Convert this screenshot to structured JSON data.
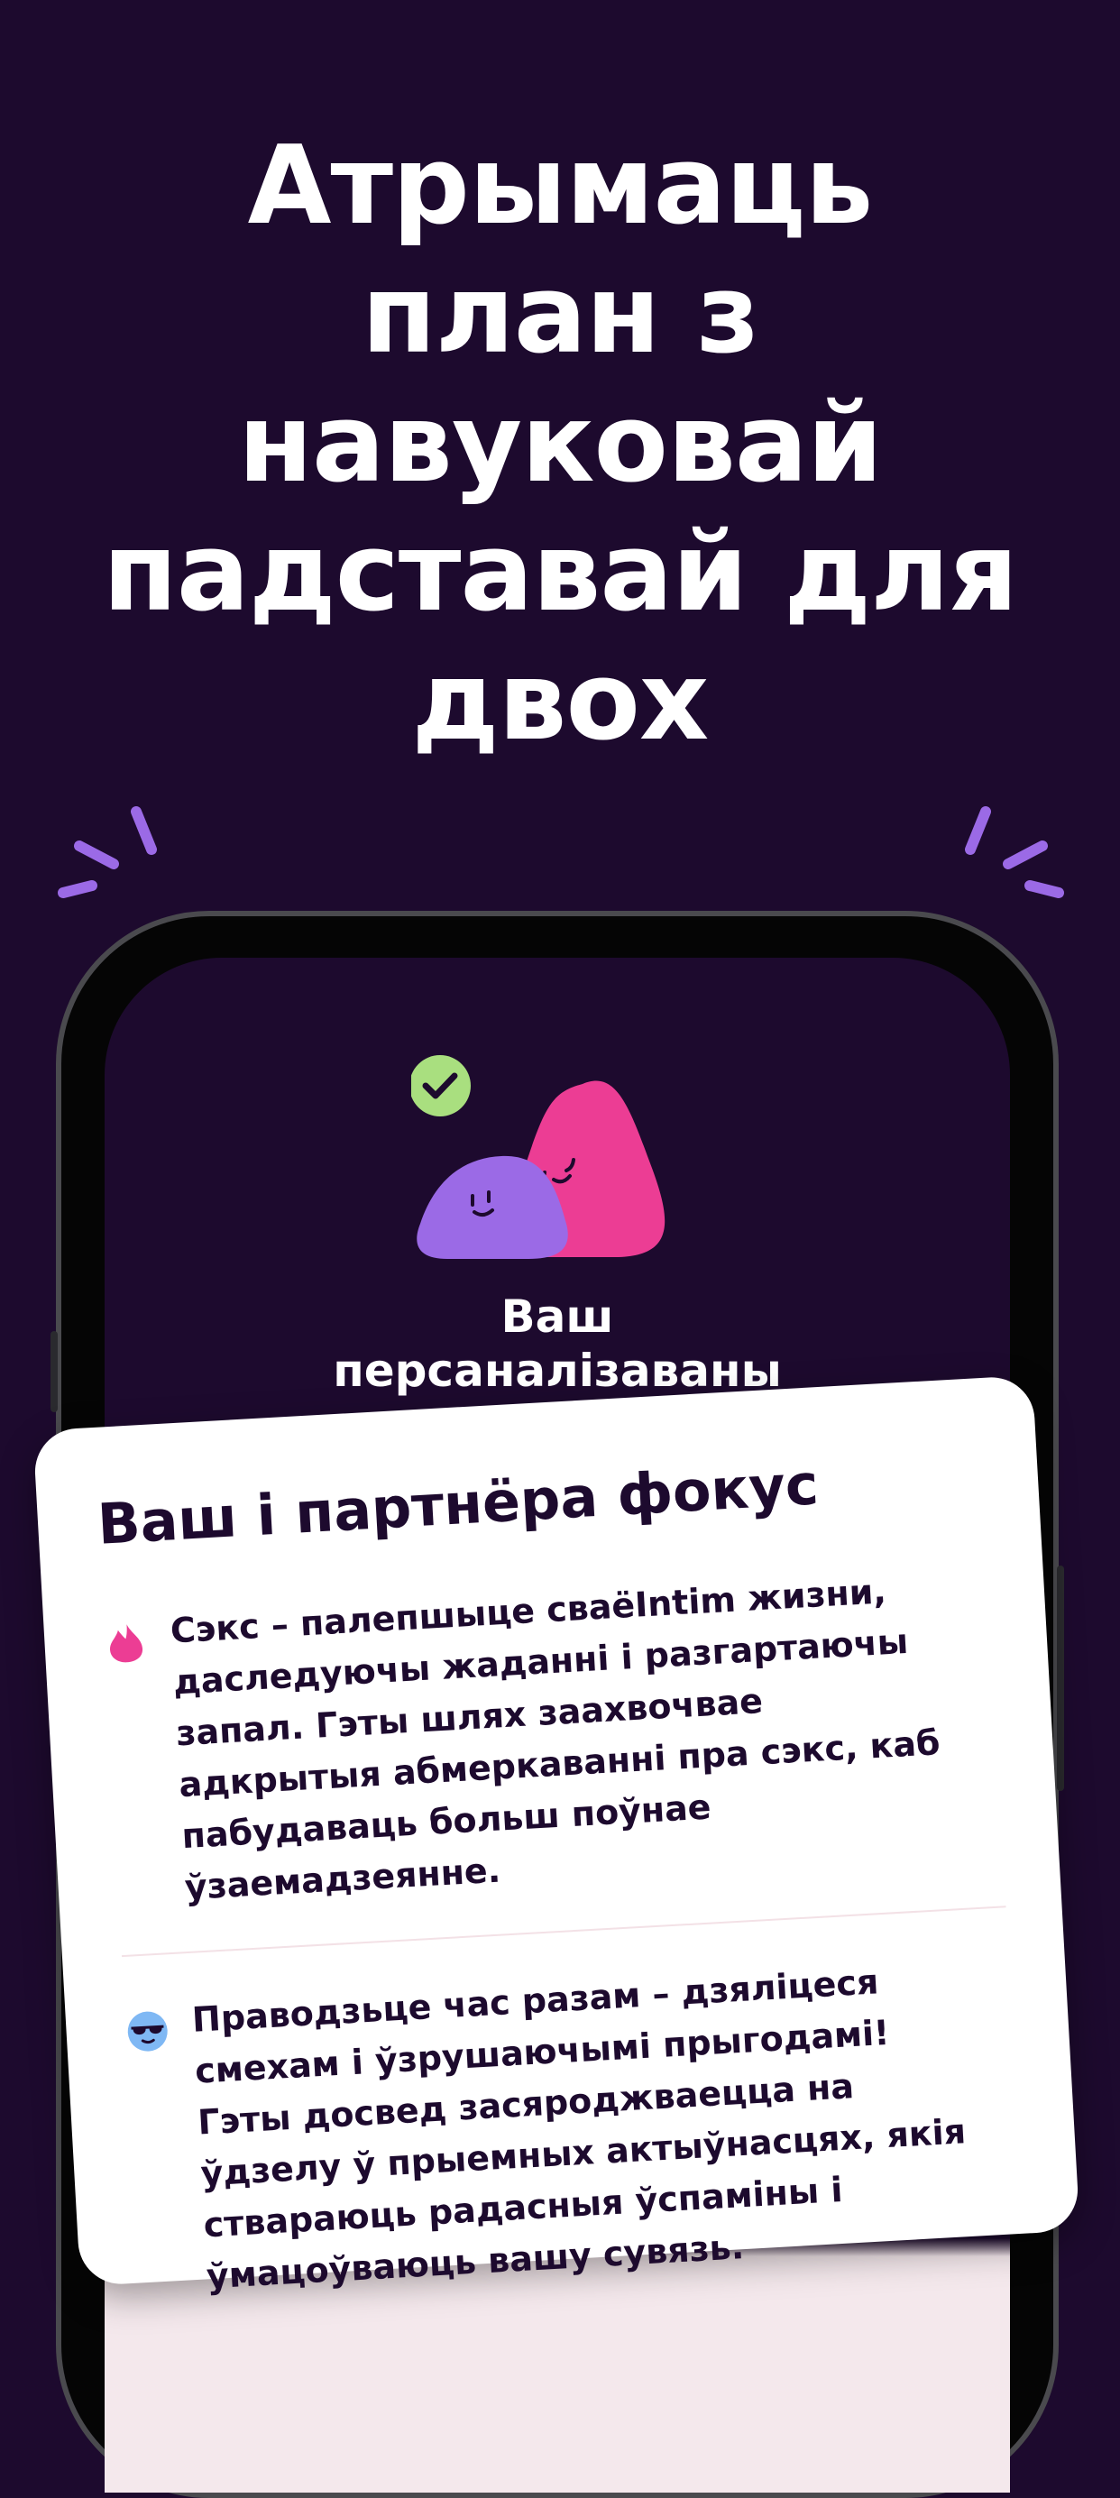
{
  "headline": {
    "lines": [
      "Атрымаць",
      "план з",
      "навуковай",
      "падставай для",
      "двох"
    ]
  },
  "phone_screen": {
    "title_lines": [
      "Ваш",
      "персаналізаваны"
    ],
    "mascot_icon": "two-blob-mascots-icon",
    "check_icon": "check-circle-icon"
  },
  "card": {
    "title": "Ваш і партнёра фокус",
    "items": [
      {
        "icon": "flame-icon",
        "lines": [
          "Сэкс – палепшыце сваёIntim жизни,",
          "даследуючы жаданні і разгартаючы",
          "запал. Гэты шлях заахвочвае",
          "адкрытыя абмеркаванні пра сэкс, каб",
          "пабудаваць больш поўнае",
          "ўзаемадзеянне."
        ]
      },
      {
        "icon": "sunglasses-face-icon",
        "lines": [
          "Праводзьце час разам – дзяліцеся",
          "смехам і ўзрушаючымі прыгодамі!",
          "Гэты досвед засяроджваецца на",
          "ўдзелу ў прыемных актыўнасцях, якія",
          "ствараюць радасныя ўспаміны і",
          "ўмацоўваюць вашу сувязь."
        ]
      }
    ]
  },
  "colors": {
    "background": "#1d0a2e",
    "accent_purple": "#9b6ae6",
    "accent_pink": "#ec3d94",
    "check_green": "#a9df7f"
  }
}
